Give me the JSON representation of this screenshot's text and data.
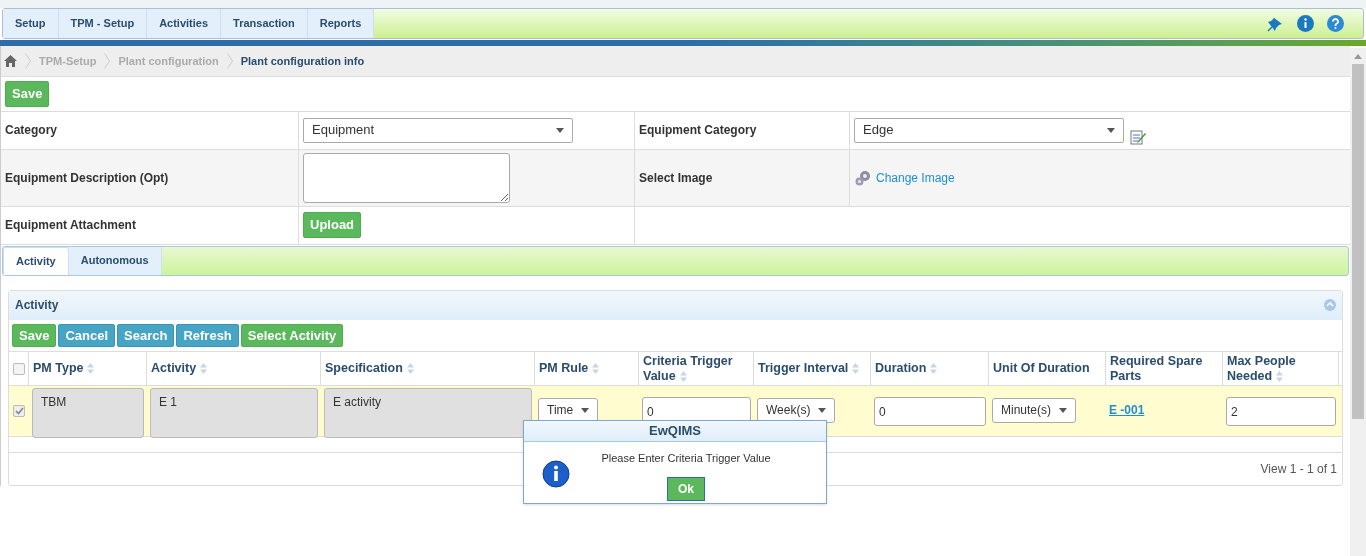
{
  "nav": {
    "items": [
      {
        "label": "Setup"
      },
      {
        "label": "TPM - Setup"
      },
      {
        "label": "Activities"
      },
      {
        "label": "Transaction"
      },
      {
        "label": "Reports"
      }
    ]
  },
  "breadcrumb": [
    "TPM-Setup",
    "Plant configuration",
    "Plant configuration info"
  ],
  "save_button": "Save",
  "form": {
    "rows": [
      {
        "label": "Category",
        "value": {
          "kind": "select",
          "text": "Equipment"
        },
        "label2": "Equipment Category",
        "value2": {
          "kind": "select",
          "text": "Edge"
        }
      },
      {
        "label": "Equipment Description (Opt)",
        "value": {
          "kind": "textarea"
        },
        "label2": "Select Image",
        "value2": {
          "kind": "image",
          "text": "Change Image"
        }
      },
      {
        "label": "Equipment Attachment",
        "value": {
          "kind": "upload",
          "text": "Upload"
        }
      }
    ]
  },
  "tabs": [
    {
      "label": "Activity",
      "selected": true
    },
    {
      "label": "Autonomous",
      "selected": false
    }
  ],
  "panel": {
    "title": "Activity",
    "buttons": [
      {
        "label": "Save",
        "kind": "success"
      },
      {
        "label": "Cancel",
        "kind": "info"
      },
      {
        "label": "Search",
        "kind": "info"
      },
      {
        "label": "Refresh",
        "kind": "info"
      },
      {
        "label": "Select Activity",
        "kind": "success"
      }
    ],
    "table": {
      "select_all_checked": false,
      "columns": [
        {
          "label": "PM Type",
          "sortable": true
        },
        {
          "label": "Activity",
          "sortable": true
        },
        {
          "label": "Specification",
          "sortable": true
        },
        {
          "label": "PM Rule",
          "sortable": true
        },
        {
          "label": "Criteria Trigger Value",
          "sortable": true
        },
        {
          "label": "Trigger Interval",
          "sortable": true
        },
        {
          "label": "Duration",
          "sortable": true
        },
        {
          "label": "Unit Of Duration",
          "sortable": false
        },
        {
          "label": "Required Spare Parts",
          "sortable": false
        },
        {
          "label": "Max People Needed",
          "sortable": true
        }
      ],
      "rows": [
        {
          "checked": true,
          "cells": [
            {
              "kind": "readonly",
              "text": "TBM"
            },
            {
              "kind": "readonly",
              "text": "E 1"
            },
            {
              "kind": "readonly",
              "text": "E activity"
            },
            {
              "kind": "select",
              "text": "Time"
            },
            {
              "kind": "input",
              "text": "0"
            },
            {
              "kind": "select",
              "text": "Week(s)"
            },
            {
              "kind": "input",
              "text": "0"
            },
            {
              "kind": "select",
              "text": "Minute(s)"
            },
            {
              "kind": "link",
              "text": "E -001"
            },
            {
              "kind": "input",
              "text": "2"
            }
          ]
        }
      ]
    },
    "pager": "View 1 - 1 of 1"
  },
  "dialog": {
    "title": "EwQIMS",
    "message": "Please Enter Criteria Trigger Value",
    "button": "Ok"
  }
}
